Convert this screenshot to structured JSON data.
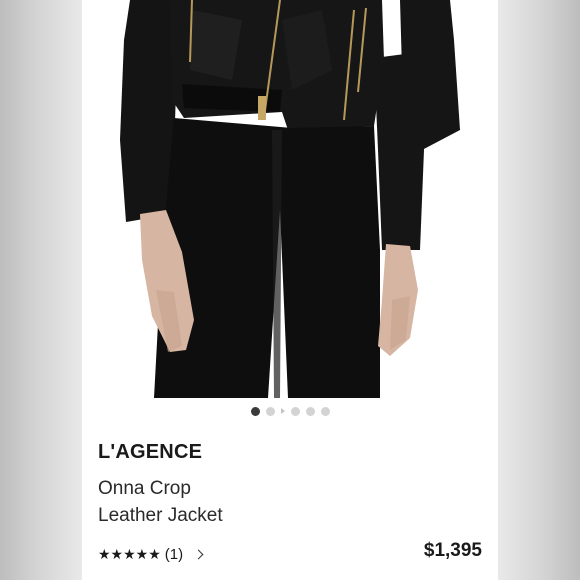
{
  "product": {
    "brand": "L'AGENCE",
    "name_line1": "Onna Crop",
    "name_line2": "Leather Jacket",
    "price": "$1,395",
    "rating_stars": "★★★★★",
    "rating_count": "(1)"
  },
  "carousel": {
    "total_slides": 6,
    "active_index": 0
  },
  "colors": {
    "background": "#ffffff",
    "text": "#1a1a1a",
    "dot_active": "#3a3a3a",
    "dot_inactive": "#d3d3d3"
  },
  "icons": {
    "rating": "star-icon",
    "more": "chevron-right-icon"
  }
}
